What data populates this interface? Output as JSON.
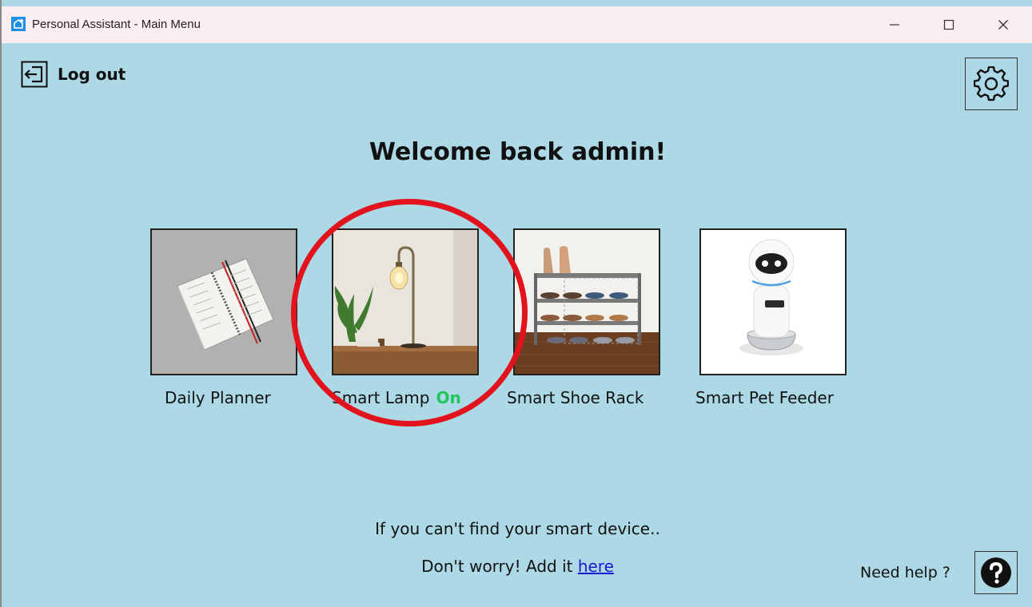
{
  "window": {
    "title": "Personal Assistant - Main Menu"
  },
  "header": {
    "logout_label": "Log out"
  },
  "main": {
    "welcome": "Welcome back admin!",
    "devices": [
      {
        "label": "Daily Planner"
      },
      {
        "label": "Smart Lamp",
        "status": "On"
      },
      {
        "label": "Smart Shoe Rack"
      },
      {
        "label": "Smart Pet Feeder"
      }
    ]
  },
  "footer": {
    "line1": "If you can't find your smart device..",
    "line2_prefix": "Don't worry! Add it ",
    "link_text": "here",
    "help_label": "Need help ?"
  },
  "icons": {
    "logout": "logout-icon",
    "settings": "gear-icon",
    "help": "question-icon",
    "minimize": "minimize-icon",
    "maximize": "maximize-icon",
    "close": "close-icon"
  },
  "colors": {
    "background": "#add8e6",
    "titlebar": "#fbeef3",
    "status_on": "#22c55e",
    "link": "#1a1ad6",
    "annotation": "#e2131d"
  }
}
